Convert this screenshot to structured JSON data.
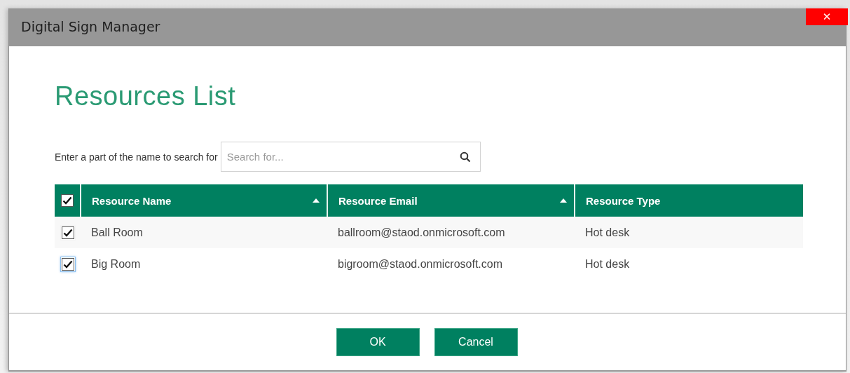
{
  "window": {
    "title": "Digital Sign Manager",
    "close_button": "✕"
  },
  "heading": "Resources List",
  "search": {
    "label": "Enter a part of the name to search for",
    "placeholder": "Search for..."
  },
  "table": {
    "select_all_checked": true,
    "columns": [
      {
        "label": "Resource Name",
        "sorted": true
      },
      {
        "label": "Resource Email",
        "sorted": true
      },
      {
        "label": "Resource Type",
        "sorted": false
      }
    ],
    "rows": [
      {
        "checked": true,
        "focused": false,
        "cells": [
          "Ball Room",
          "ballroom@staod.onmicrosoft.com",
          "Hot desk"
        ]
      },
      {
        "checked": true,
        "focused": true,
        "cells": [
          "Big Room",
          "bigroom@staod.onmicrosoft.com",
          "Hot desk"
        ]
      }
    ]
  },
  "buttons": [
    "OK",
    "Cancel"
  ]
}
